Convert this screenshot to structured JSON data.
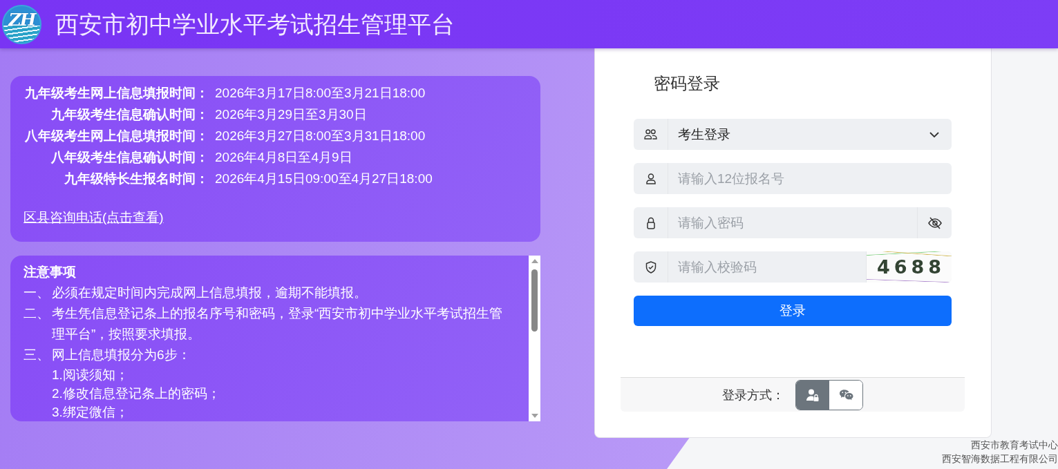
{
  "header": {
    "logo_text": "ZH",
    "title": "西安市初中学业水平考试招生管理平台"
  },
  "schedule": {
    "rows": [
      {
        "label": "九年级考生网上信息填报时间：",
        "value": "2026年3月17日8:00至3月21日18:00"
      },
      {
        "label": "九年级考生信息确认时间：",
        "value": "2026年3月29日至3月30日"
      },
      {
        "label": "八年级考生网上信息填报时间：",
        "value": "2026年3月27日8:00至3月31日18:00"
      },
      {
        "label": "八年级考生信息确认时间：",
        "value": "2026年4月8日至4月9日"
      },
      {
        "label": "九年级特长生报名时间：",
        "value": "2026年4月15日09:00至4月27日18:00"
      }
    ],
    "link": "区县咨询电话(点击查看)"
  },
  "notices": {
    "title": "注意事项",
    "items": [
      {
        "marker": "一、",
        "text": "必须在规定时间内完成网上信息填报，逾期不能填报。"
      },
      {
        "marker": "二、",
        "text": "考生凭信息登记条上的报名序号和密码，登录“西安市初中学业水平考试招生管理平台”，按照要求填报。"
      },
      {
        "marker": "三、",
        "text": "网上信息填报分为6步：",
        "children": [
          {
            "text": "1.阅读须知；"
          },
          {
            "text": "2.修改信息登记条上的密码；"
          },
          {
            "text": "3.绑定微信；"
          }
        ]
      }
    ]
  },
  "login": {
    "title": "密码登录",
    "role_select": {
      "value": "考生登录"
    },
    "id_field": {
      "placeholder": "请输入12位报名号"
    },
    "password_field": {
      "placeholder": "请输入密码",
      "password_visible": false
    },
    "captcha_field": {
      "placeholder": "请输入校验码",
      "captcha_code": "4688"
    },
    "submit": "登录",
    "method_label": "登录方式：",
    "methods": [
      {
        "kind": "password",
        "selected": true
      },
      {
        "kind": "wechat",
        "selected": false
      }
    ]
  },
  "footer": [
    "西安市教育考试中心",
    "西安智海数据工程有限公司"
  ]
}
